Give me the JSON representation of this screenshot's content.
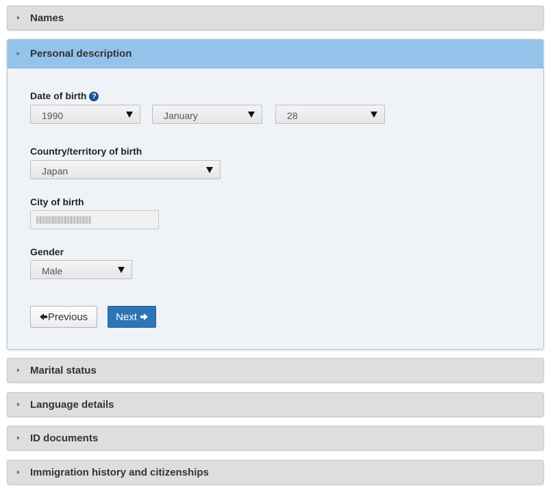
{
  "sections": {
    "names": "Names",
    "personal_description": "Personal description",
    "marital_status": "Marital status",
    "language_details": "Language details",
    "id_documents": "ID documents",
    "immigration_history": "Immigration history and citizenships"
  },
  "form": {
    "dob_label": "Date of birth",
    "help_icon": "?",
    "dob_year": "1990",
    "dob_month": "January",
    "dob_day": "28",
    "country_label": "Country/territory of birth",
    "country_value": "Japan",
    "city_label": "City of birth",
    "gender_label": "Gender",
    "gender_value": "Male"
  },
  "buttons": {
    "previous": "Previous",
    "next": "Next"
  },
  "colors": {
    "active_header": "#93c3ea",
    "primary_button": "#2f74b5"
  }
}
